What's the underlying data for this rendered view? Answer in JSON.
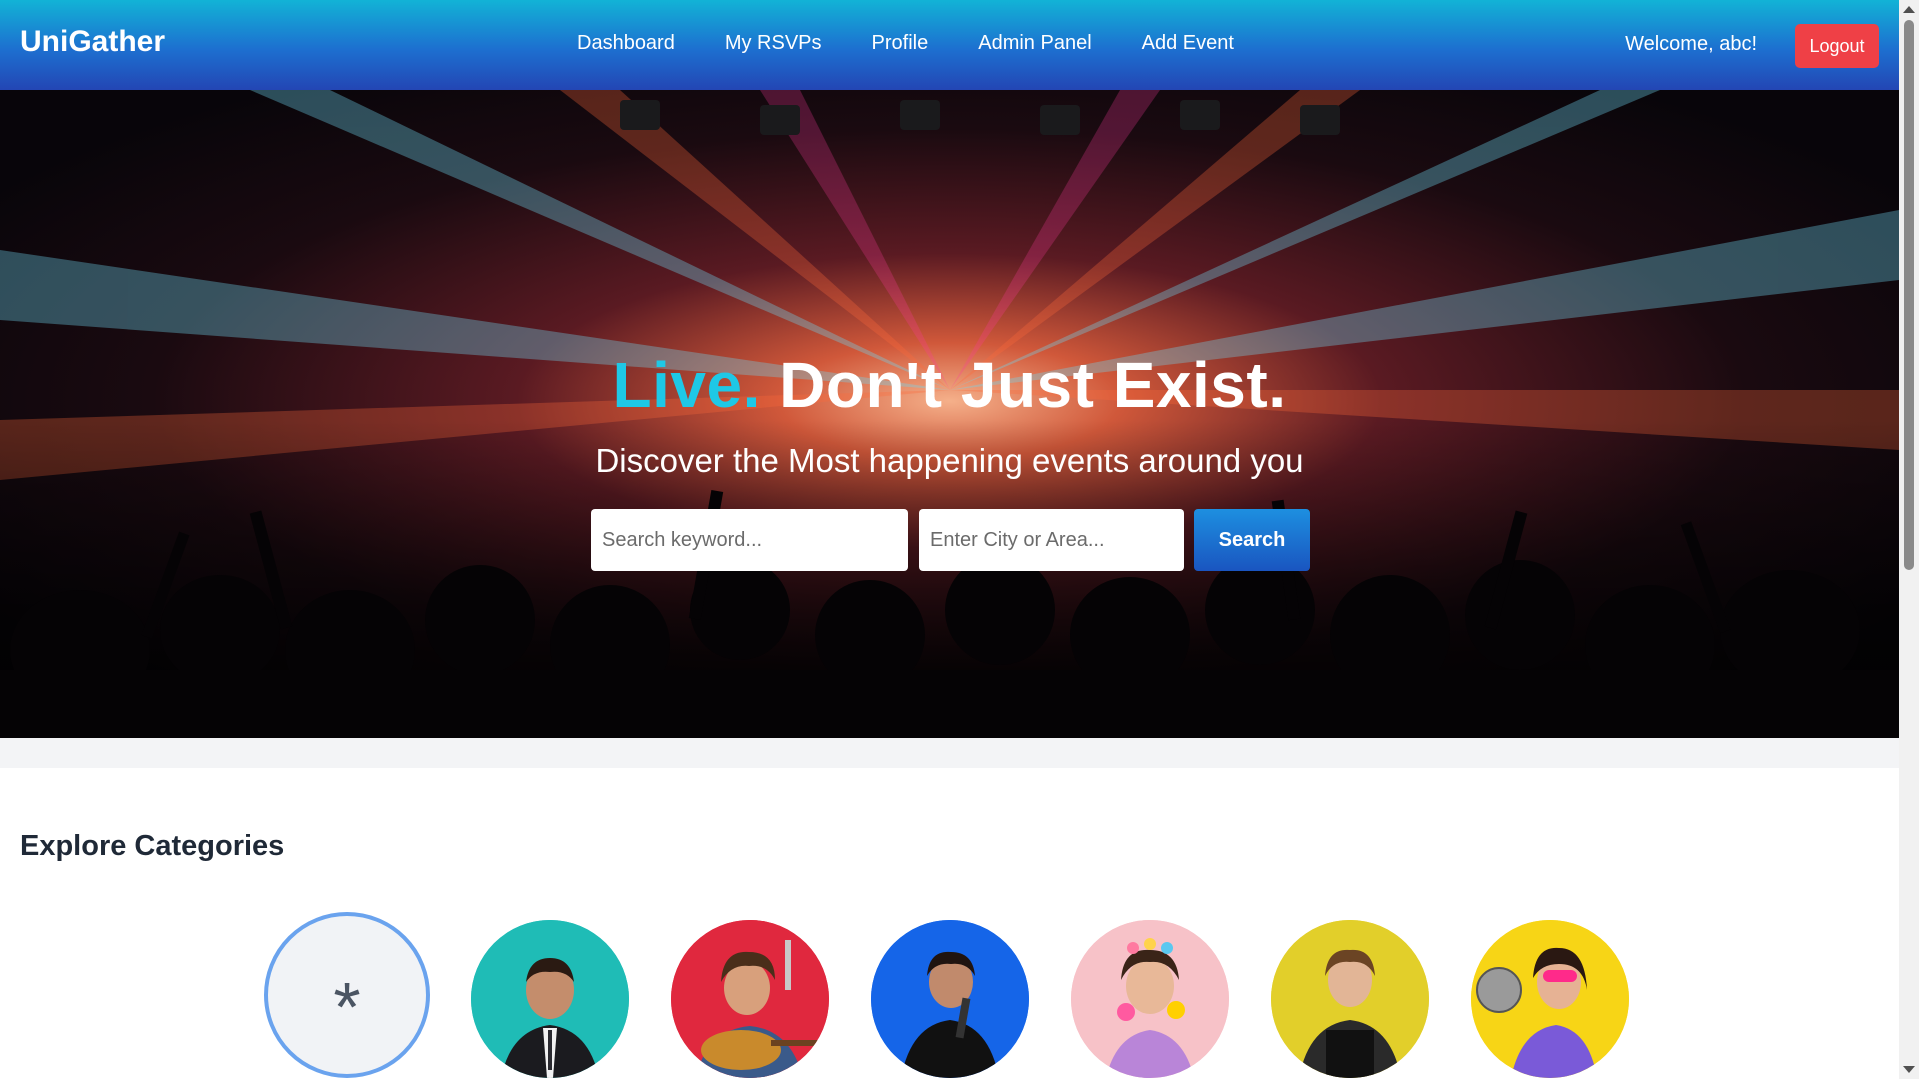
{
  "navbar": {
    "brand": "UniGather",
    "links": [
      "Dashboard",
      "My RSVPs",
      "Profile",
      "Admin Panel",
      "Add Event"
    ],
    "welcome": "Welcome, abc!",
    "logout_label": "Logout"
  },
  "hero": {
    "title_accent": "Live.",
    "title_rest": "Don't Just Exist.",
    "subtitle": "Discover the Most happening events around you",
    "keyword_placeholder": "Search keyword...",
    "city_placeholder": "Enter City or Area...",
    "search_label": "Search"
  },
  "categories": {
    "title": "Explore Categories",
    "all_icon": "*",
    "items": [
      {
        "name": "category-businessman",
        "color": "#1fbcb6"
      },
      {
        "name": "category-guitarist",
        "color": "#e0283e"
      },
      {
        "name": "category-singer",
        "color": "#1565e8"
      },
      {
        "name": "category-festival",
        "color": "#f7c2c8"
      },
      {
        "name": "category-chef",
        "color": "#e2cf2a"
      },
      {
        "name": "category-disco",
        "color": "#f7d516"
      }
    ]
  },
  "colors": {
    "accent": "#1ec8e6",
    "logout": "#ef4046",
    "nav_gradient_top": "#12b3d6",
    "nav_gradient_bottom": "#2346b4"
  }
}
